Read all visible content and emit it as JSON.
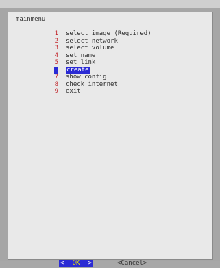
{
  "dialog": {
    "title": "mainmenu"
  },
  "menu": {
    "items": [
      {
        "num": "1",
        "label": "select image (Required)",
        "selected": false
      },
      {
        "num": "2",
        "label": "select network",
        "selected": false
      },
      {
        "num": "3",
        "label": "select volume",
        "selected": false
      },
      {
        "num": "4",
        "label": "set name",
        "selected": false
      },
      {
        "num": "5",
        "label": "set link",
        "selected": false
      },
      {
        "num": "6",
        "label": "create",
        "selected": true
      },
      {
        "num": "7",
        "label": "show config",
        "selected": false
      },
      {
        "num": "8",
        "label": "check internet",
        "selected": false
      },
      {
        "num": "9",
        "label": "exit",
        "selected": false
      }
    ]
  },
  "buttons": {
    "ok_left": "<",
    "ok_label": "OK",
    "ok_right": ">",
    "cancel_label": "<Cancel>"
  },
  "colors": {
    "selection": "#2b2bd4",
    "number": "#c2252a",
    "hotkey": "#e7e000",
    "dialog_bg": "#e9e9e9",
    "screen_bg": "#a6a6a6"
  }
}
